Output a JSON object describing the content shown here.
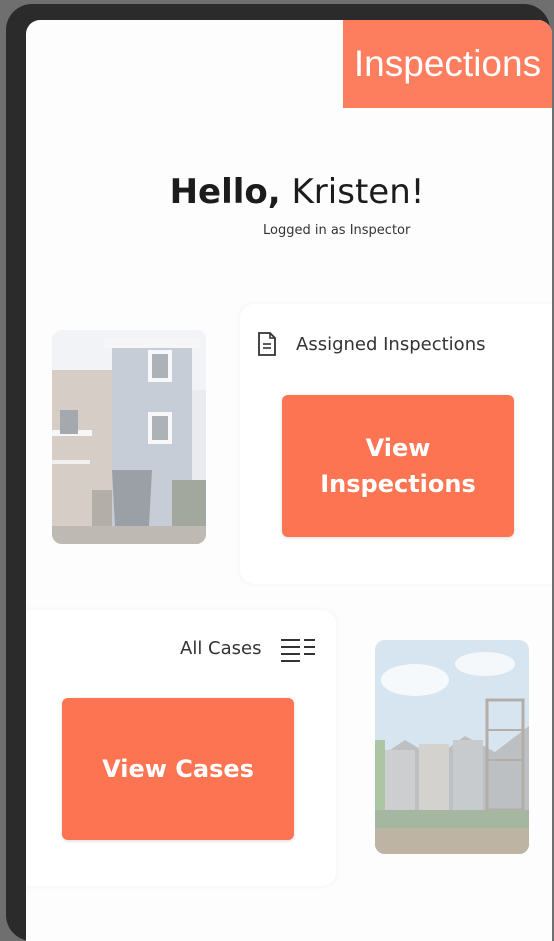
{
  "header": {
    "title": "Inspections"
  },
  "greeting": {
    "hello": "Hello,",
    "name": "Kristen!",
    "role_text": "Logged in as Inspector"
  },
  "inspections_card": {
    "label": "Assigned Inspections",
    "icon": "document-icon",
    "button_line1": "View",
    "button_line2": "Inspections"
  },
  "cases_card": {
    "label": "All Cases",
    "icon": "list-icon",
    "button_label": "View Cases"
  },
  "colors": {
    "accent": "#fd7452",
    "background": "#fdfdfd",
    "frame": "#2b2b2b"
  }
}
